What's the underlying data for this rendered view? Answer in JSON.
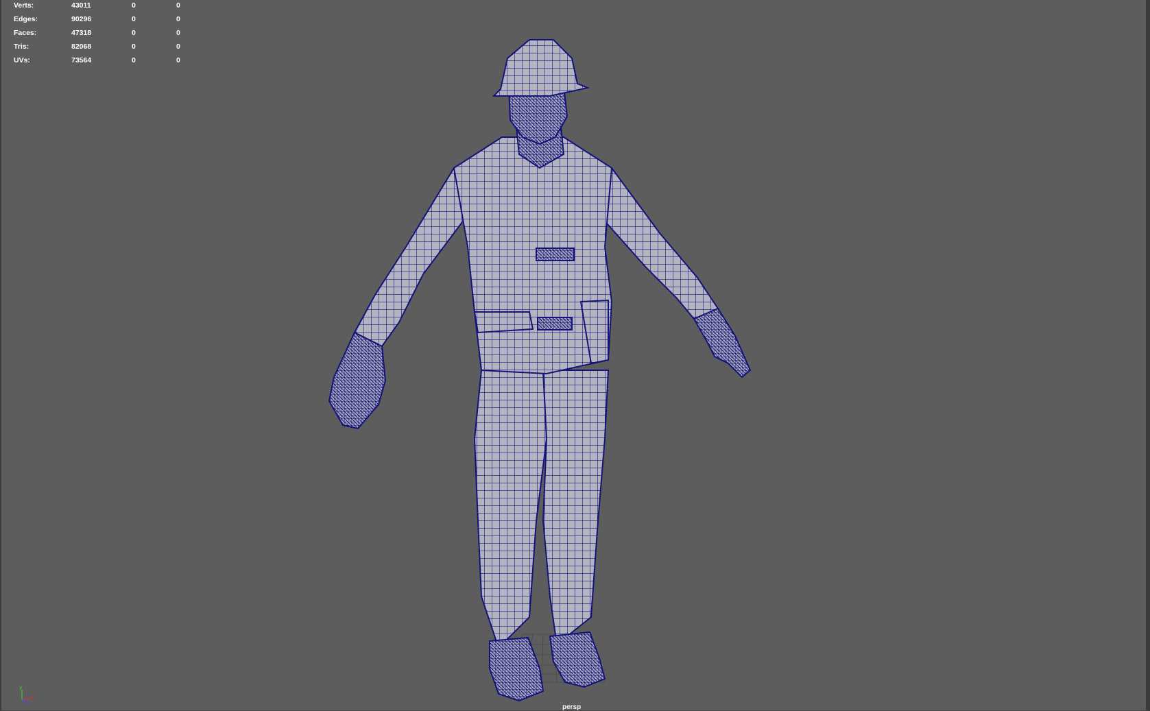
{
  "viewport": {
    "camera": "persp",
    "background_color": "#5d5d5d",
    "wire_color": "#13137a",
    "shade_color": "#b4b4c0"
  },
  "hud": {
    "rows": [
      {
        "label": "Verts:",
        "total": "43011",
        "selected": "0",
        "components": "0"
      },
      {
        "label": "Edges:",
        "total": "90296",
        "selected": "0",
        "components": "0"
      },
      {
        "label": "Faces:",
        "total": "47318",
        "selected": "0",
        "components": "0"
      },
      {
        "label": "Tris:",
        "total": "82068",
        "selected": "0",
        "components": "0"
      },
      {
        "label": "UVs:",
        "total": "73564",
        "selected": "0",
        "components": "0"
      }
    ]
  },
  "axis_gizmo": {
    "icon": "xyz-axis-icon",
    "labels": {
      "x": "x",
      "y": "y",
      "z": "z"
    },
    "colors": {
      "x": "#e03030",
      "y": "#30d030",
      "z": "#3060ff"
    }
  },
  "model": {
    "icon": "wireframe-construction-worker"
  }
}
